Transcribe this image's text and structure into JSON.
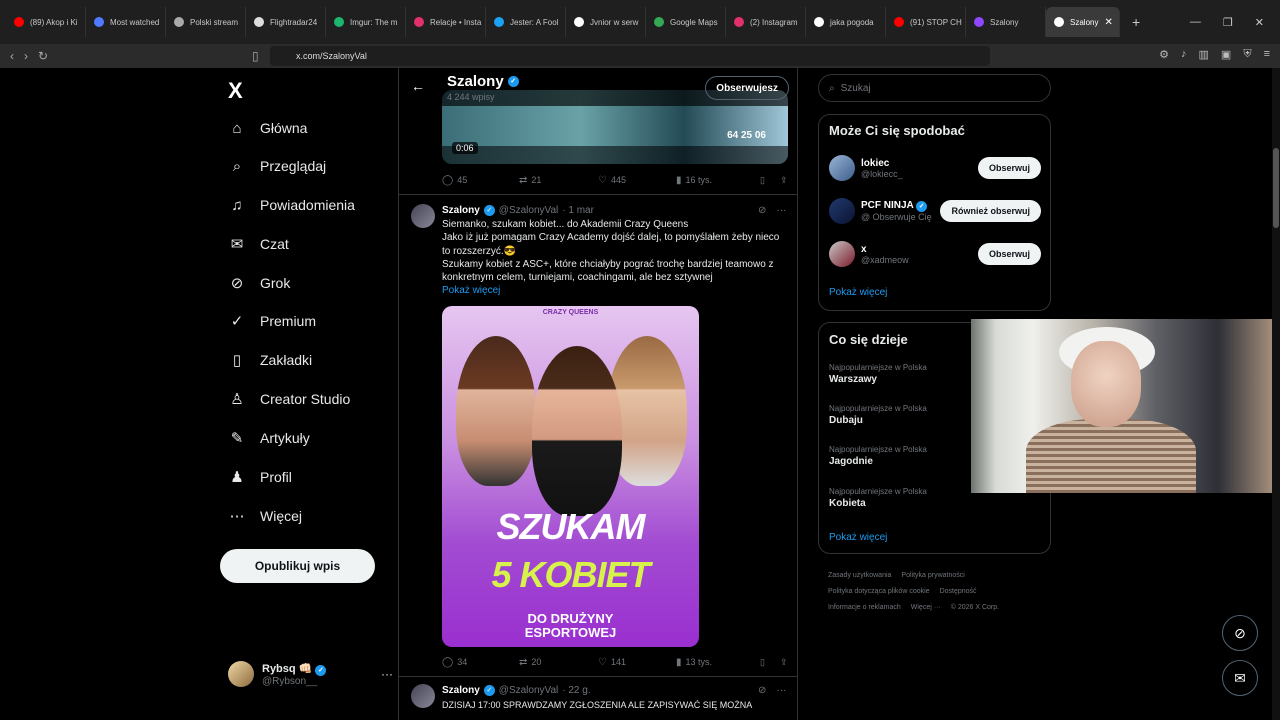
{
  "browser": {
    "tabs": [
      {
        "label": "(89) Akop i Ki",
        "color": "#ff0000"
      },
      {
        "label": "Most watched",
        "color": "#4f7cff"
      },
      {
        "label": "Polski stream",
        "color": "#aaaaaa"
      },
      {
        "label": "Flightradar24",
        "color": "#dddddd"
      },
      {
        "label": "Imgur: The m",
        "color": "#1bb76e"
      },
      {
        "label": "Relacje • Insta",
        "color": "#e1306c"
      },
      {
        "label": "Jester: A Fool",
        "color": "#1da1f2"
      },
      {
        "label": "Jvnior w serw",
        "color": "#ffffff"
      },
      {
        "label": "Google Maps",
        "color": "#34a853"
      },
      {
        "label": "(2) Instagram",
        "color": "#e1306c"
      },
      {
        "label": "jaka pogoda",
        "color": "#ffffff"
      },
      {
        "label": "(91) STOP CH",
        "color": "#ff0000"
      },
      {
        "label": "Szalony",
        "color": "#9146ff"
      }
    ],
    "active_tab": "Szalony",
    "url": "x.com/SzalonyVal"
  },
  "nav": {
    "logo": "X",
    "items": [
      {
        "label": "Główna",
        "icon": "⌂"
      },
      {
        "label": "Przeglądaj",
        "icon": "⌕"
      },
      {
        "label": "Powiadomienia",
        "icon": "♫"
      },
      {
        "label": "Czat",
        "icon": "✉"
      },
      {
        "label": "Grok",
        "icon": "⊘"
      },
      {
        "label": "Premium",
        "icon": "✓"
      },
      {
        "label": "Zakładki",
        "icon": "▯"
      },
      {
        "label": "Creator Studio",
        "icon": "♙"
      },
      {
        "label": "Artykuły",
        "icon": "✎"
      },
      {
        "label": "Profil",
        "icon": "♟"
      },
      {
        "label": "Więcej",
        "icon": "⋯"
      }
    ],
    "post_button": "Opublikuj wpis",
    "profile": {
      "name": "Rybsq 👊🏻",
      "handle": "@Rybson__",
      "more": "···"
    }
  },
  "header": {
    "name": "Szalony",
    "count": "4 244 wpisy",
    "follow_label": "Obserwujesz",
    "back": "←"
  },
  "video": {
    "time": "0:06",
    "score": "64 25 06"
  },
  "tweet1_actions": {
    "replies": "45",
    "retweets": "21",
    "likes": "445",
    "views": "16 tys."
  },
  "tweet2": {
    "name": "Szalony",
    "handle": "@SzalonyVal",
    "date": "· 1 mar",
    "lines": [
      "Siemanko, szukam kobiet... do Akademii Crazy Queens",
      "Jako iż już pomagam Crazy Academy dojść dalej, to pomyślałem żeby nieco to rozszerzyć.😎",
      "Szukamy kobiet z ASC+, które chciałyby pograć trochę bardziej teamowo z konkretnym celem, turniejami, coachingami, ale bez sztywnej"
    ],
    "show_more": "Pokaż więcej",
    "image": {
      "brand": "CRAZY QUEENS",
      "line1": "SZUKAM",
      "line2": "5 KOBIET",
      "line3": "DO DRUŻYNY",
      "line4": "ESPORTOWEJ"
    },
    "actions": {
      "replies": "34",
      "retweets": "20",
      "likes": "141",
      "views": "13 tys."
    }
  },
  "tweet3": {
    "name": "Szalony",
    "handle": "@SzalonyVal",
    "date": "· 22 g.",
    "text": "DZISIAJ 17:00 SPRAWDZAMY ZGŁOSZENIA ALE ZAPISYWAĆ SIĘ MOŻNA"
  },
  "search": {
    "placeholder": "Szukaj"
  },
  "suggestions": {
    "title": "Może Ci się spodobać",
    "users": [
      {
        "name": "lokiec",
        "handle": "@lokiecc_",
        "button": "Obserwuj"
      },
      {
        "name": "PCF NINJA",
        "handle": "@ Obserwuje Cię",
        "button": "Również obserwuj"
      },
      {
        "name": "x",
        "handle": "@xadmeow",
        "button": "Obserwuj"
      }
    ],
    "more": "Pokaż więcej"
  },
  "trends": {
    "title": "Co się dzieje",
    "items": [
      {
        "category": "Najpopularniejsze w Polska",
        "topic": "Warszawy"
      },
      {
        "category": "Najpopularniejsze w Polska",
        "topic": "Dubaju"
      },
      {
        "category": "Najpopularniejsze w Polska",
        "topic": "Jagodnie"
      },
      {
        "category": "Najpopularniejsze w Polska",
        "topic": "Kobieta"
      }
    ],
    "more": "Pokaż więcej"
  },
  "footer": {
    "links": [
      "Zasady użytkowania",
      "Polityka prywatności",
      "Polityka dotycząca plików cookie",
      "Dostępność",
      "Informacje o reklamach",
      "Więcej ···"
    ],
    "copyright": "© 2026 X Corp."
  }
}
